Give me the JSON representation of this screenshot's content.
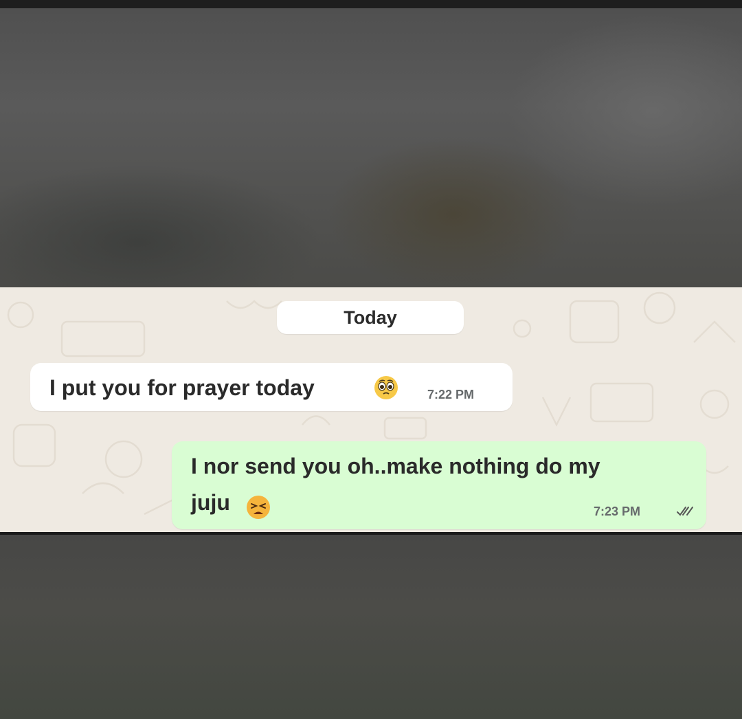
{
  "chat": {
    "date_label": "Today",
    "messages": [
      {
        "direction": "incoming",
        "text": "I put you for prayer today",
        "emoji": "pleading-face-emoji",
        "time": "7:22 PM"
      },
      {
        "direction": "outgoing",
        "line1": "I nor send you oh..make nothing do my",
        "line2": "juju",
        "emoji": "tired-face-emoji",
        "time": "7:23 PM",
        "status": "read-double-check"
      }
    ]
  },
  "colors": {
    "wallpaper": "#efeae2",
    "incoming_bubble": "#ffffff",
    "outgoing_bubble": "#d9fdd3",
    "read_ticks": "#555555",
    "blurred_background": "#505050"
  }
}
